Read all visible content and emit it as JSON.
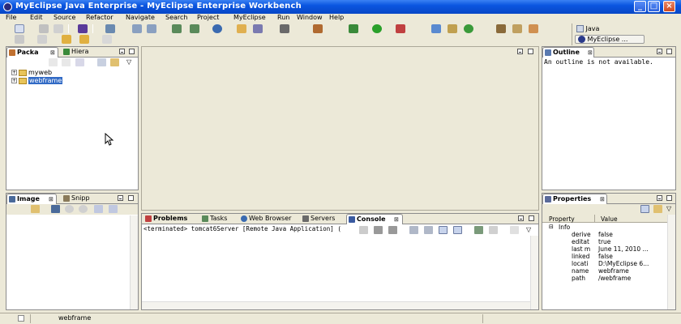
{
  "window": {
    "title": "MyEclipse Java Enterprise - MyEclipse Enterprise Workbench"
  },
  "menu": [
    "File",
    "Edit",
    "Source",
    "Refactor",
    "Navigate",
    "Search",
    "Project",
    "MyEclipse",
    "Run",
    "Window",
    "Help"
  ],
  "perspectives": {
    "java": "Java",
    "myeclipse": "MyEclipse ..."
  },
  "package_explorer": {
    "tabs": [
      "Packa",
      "Hiera"
    ],
    "items": [
      {
        "label": "myweb",
        "selected": false
      },
      {
        "label": "webframe",
        "selected": true
      }
    ]
  },
  "outline": {
    "tab": "Outline",
    "message": "An outline is not available."
  },
  "image_panel": {
    "tabs": [
      "Image",
      "Snipp"
    ]
  },
  "console": {
    "tabs": [
      "Problems",
      "Tasks",
      "Web Browser",
      "Servers",
      "Console"
    ],
    "status": "<terminated> tomcat6Server [Remote Java Application] ("
  },
  "properties": {
    "tab": "Properties",
    "columns": [
      "Property",
      "Value"
    ],
    "group": "Info",
    "rows": [
      {
        "k": "derive",
        "v": "false"
      },
      {
        "k": "editat",
        "v": "true"
      },
      {
        "k": "last m",
        "v": "June 11, 2010 ..."
      },
      {
        "k": "linked",
        "v": "false"
      },
      {
        "k": "locati",
        "v": "D:\\MyEclipse 6..."
      },
      {
        "k": "name",
        "v": "webframe"
      },
      {
        "k": "path",
        "v": "/webframe"
      }
    ]
  },
  "statusbar": {
    "text": "webframe"
  },
  "colors": {
    "title_blue": "#0a55e0",
    "selection": "#316ac5",
    "frame": "#ece9d8"
  }
}
